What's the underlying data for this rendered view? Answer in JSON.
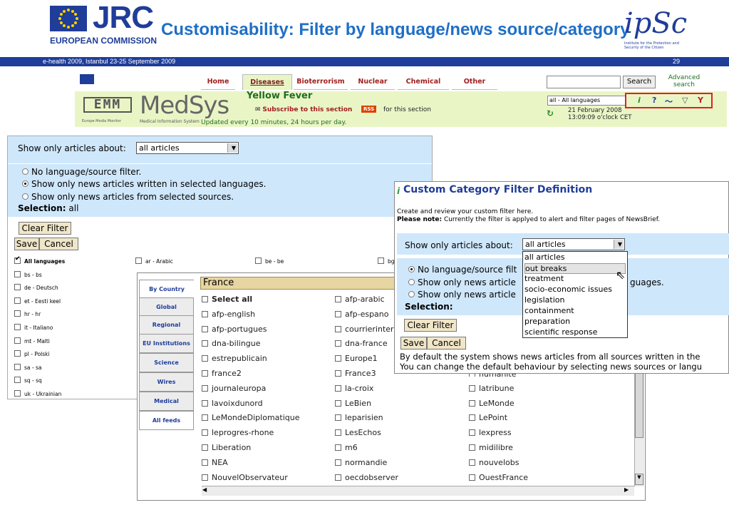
{
  "slide": {
    "jrc": "JRC",
    "ec": "EUROPEAN COMMISSION",
    "title": "Customisability: Filter by language/news source/category",
    "ipsc": "ipSc",
    "ipsc_sub": "Institute for the Protection and Security of the Citizen",
    "event": "e-health 2009, Istanbul 23-25 September 2009",
    "page_number": "29"
  },
  "medisys": {
    "tabs": [
      "Home",
      "Diseases",
      "Bioterrorism",
      "Nuclear",
      "Chemical",
      "Other"
    ],
    "active_tab": "Diseases",
    "emm_logo": "EMM",
    "emm_sub": "Europe Media Monitor",
    "brand": "MedSys",
    "brand_sub": "Medical Information System",
    "section_title": "Yellow Fever",
    "subscribe": "Subscribe to this section",
    "rss": "RSS",
    "for_section": "for this section",
    "updated": "Updated every 10 minutes, 24 hours per day.",
    "search_button": "Search",
    "advanced_search": "Advanced search",
    "language_select": "all - All languages",
    "date": "21 February 2008",
    "time": "13:09:09 o'clock CET"
  },
  "filter_panel": {
    "show_label": "Show only articles about:",
    "show_value": "all articles",
    "options": [
      "No language/source filter.",
      "Show only news articles written in selected languages.",
      "Show only news articles from selected sources."
    ],
    "selected_option": 1,
    "selection_label": "Selection:",
    "selection_value": "all",
    "clear_filter": "Clear Filter",
    "save": "Save",
    "cancel": "Cancel",
    "languages": [
      [
        "All languages",
        "bs - bs",
        "de - Deutsch",
        "et - Eesti keel",
        "hr - hr",
        "it - Italiano",
        "mt - Malti",
        "pl - Polski",
        "sa - sa",
        "sq - sq",
        "uk - Ukrainian"
      ],
      [
        "ar - Arabic"
      ],
      [
        "be - be"
      ],
      [
        "bg"
      ]
    ]
  },
  "source_panel": {
    "side_tabs": [
      "By Country",
      "Global",
      "Regional",
      "EU Institutions",
      "Science",
      "Wires",
      "Medical",
      "All feeds"
    ],
    "country": "France",
    "sources": [
      [
        "Select all",
        "afp-english",
        "afp-portugues",
        "dna-bilingue",
        "estrepublicain",
        "france2",
        "journaleuropa",
        "lavoixdunord",
        "LeMondeDiplomatique",
        "leprogres-rhone",
        "Liberation",
        "NEA",
        "NouvelObservateur"
      ],
      [
        "afp-arabic",
        "afp-espano",
        "courrierinter",
        "dna-france",
        "Europe1",
        "France3",
        "la-croix",
        "LeBien",
        "leparisien",
        "LesEchos",
        "m6",
        "normandie",
        "oecdobserver"
      ],
      [
        "humanite",
        "latribune",
        "LeMonde",
        "LePoint",
        "lexpress",
        "midilibre",
        "nouvelobs",
        "OuestFrance"
      ]
    ]
  },
  "category_panel": {
    "title": "Custom Category Filter Definition",
    "desc1": "Create and review your custom filter here.",
    "note_label": "Please note:",
    "note": "Currently the filter is applyed to alert and filter pages of NewsBrief.",
    "show_label": "Show only articles about:",
    "show_value": "all articles",
    "dropdown_options": [
      "all articles",
      "out breaks",
      "treatment",
      "socio-economic issues",
      "legislation",
      "containment",
      "preparation",
      "scientific response"
    ],
    "highlighted_option": "out breaks",
    "opt1": "No language/source filt",
    "opt2a": "Show only news article",
    "opt2b": "guages.",
    "opt3": "Show only news article",
    "selection_label": "Selection:",
    "clear_filter": "Clear Filter",
    "save": "Save",
    "cancel": "Cancel",
    "footer1": "By default the system shows news articles from all sources written in the",
    "footer2": "You can change the default behaviour by selecting news sources or langu"
  }
}
